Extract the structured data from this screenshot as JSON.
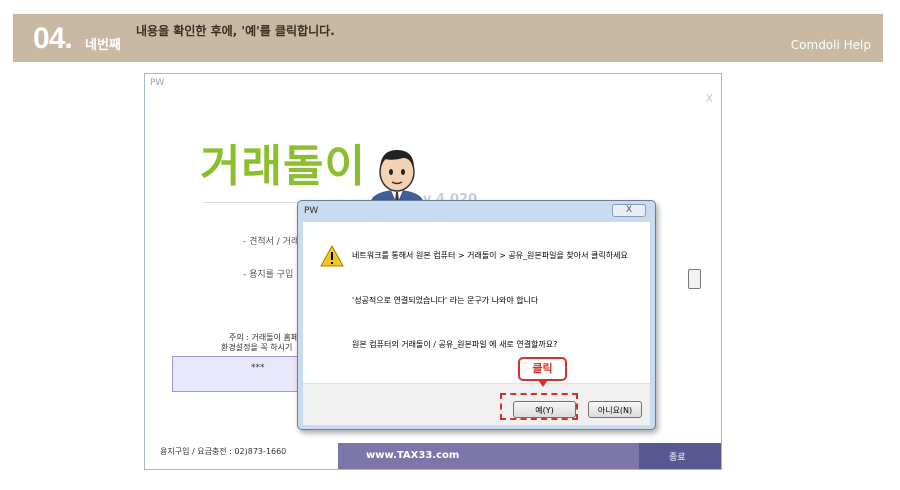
{
  "header": {
    "step_number": "04",
    "step_word": "네번째",
    "instruction": "내용을 확인한 후에, '예'를 클릭합니다.",
    "help_label": "Comdoli Help"
  },
  "background_window": {
    "title": "PW",
    "close": "X",
    "logo_text": "거래돌이",
    "version": "v 4.020",
    "line1": "- 견적서 / 거래",
    "line2": "- 용지를 구입",
    "warning_line1": "주의 : 거래돌이 홈페",
    "warning_line2": "환경설정을 꼭 하시기",
    "box_text": "***",
    "footer_text": "용지구입 / 요금충전 : 02)873-1660",
    "url": "www.TAX33.com",
    "exit_label": "종료"
  },
  "dialog": {
    "title": "PW",
    "close_label": "X",
    "message_line1": "네트워크를 통해서 원본 컴퓨터 > 거래돌이 > 공유_원본파일을 찾아서 클릭하세요",
    "message_line2": "'성공적으로 연결되었습니다' 라는 문구가 나와야 합니다",
    "message_line3": "원본 컴퓨터의 거래돌이 / 공유_원본파일 에 새로 연결할까요?",
    "yes_label": "예(Y)",
    "no_label": "아니요(N)"
  },
  "callout": {
    "label": "클릭",
    "color": "#d3312c"
  },
  "colors": {
    "header_bg": "#c9b8a2",
    "logo_green": "#8cbf2f",
    "url_bar": "#7b78a9"
  }
}
